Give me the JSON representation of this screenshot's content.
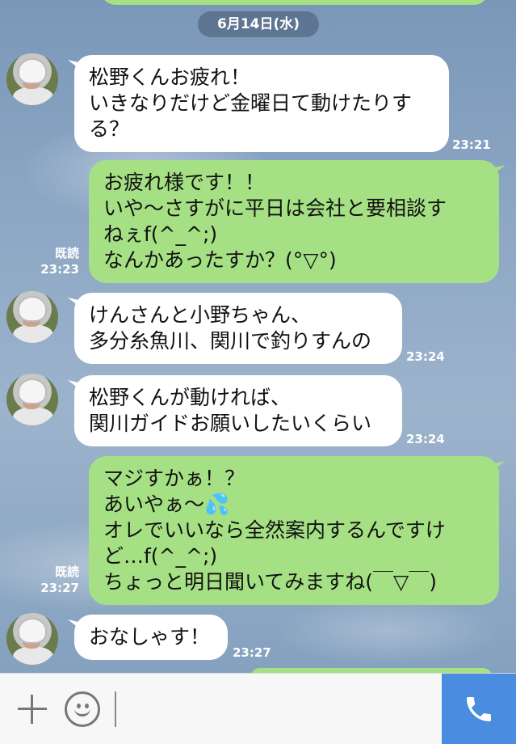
{
  "date_label": "6月14日(水)",
  "messages": [
    {
      "side": "in",
      "text": "松野くんお疲れ！\nいきなりだけど金曜日て動けたりす\nる？",
      "time": "23:21"
    },
    {
      "side": "out",
      "text": "お疲れ様です！！\nいや〜さすがに平日は会社と要相談す\nねぇf(^_^;)\nなんかあったすか？(°▽°)",
      "time": "23:23",
      "read": "既読"
    },
    {
      "side": "in",
      "text": "けんさんと小野ちゃん、\n多分糸魚川、関川で釣りすんの",
      "time": "23:24"
    },
    {
      "side": "in",
      "text": "松野くんが動ければ、\n関川ガイドお願いしたいくらい",
      "time": "23:24"
    },
    {
      "side": "out",
      "text": "マジすかぁ！？\nあいやぁ〜💦\nオレでいいなら全然案内するんですけ\nど…f(^_^;)\nちょっと明日聞いてみますね(￣▽￣)",
      "time": "23:27",
      "read": "既読"
    },
    {
      "side": "in",
      "text": "おなしゃす！",
      "time": "23:27"
    }
  ],
  "input": {
    "placeholder": "",
    "value": ""
  },
  "colors": {
    "outgoing_bubble": "#a6e085",
    "incoming_bubble": "#ffffff",
    "call_button": "#4a8ce0"
  }
}
